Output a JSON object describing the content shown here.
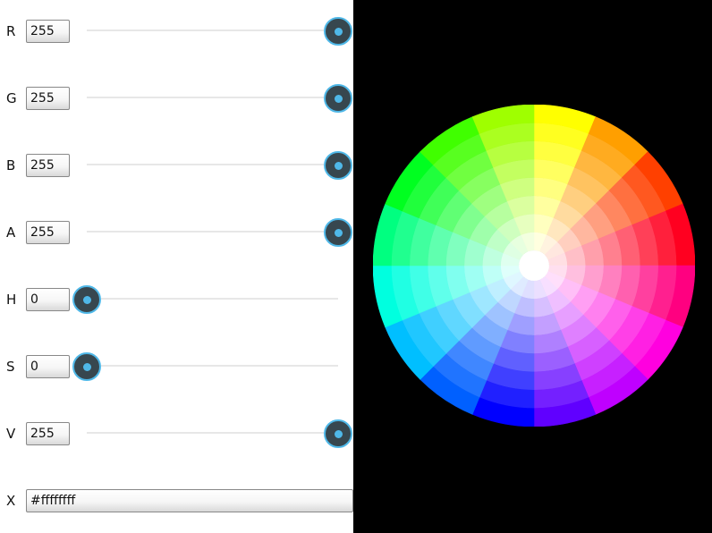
{
  "controls": {
    "rows": [
      {
        "key": "r",
        "label": "R",
        "value": "255",
        "slider_fraction": 1.0
      },
      {
        "key": "g",
        "label": "G",
        "value": "255",
        "slider_fraction": 1.0
      },
      {
        "key": "b",
        "label": "B",
        "value": "255",
        "slider_fraction": 1.0
      },
      {
        "key": "a",
        "label": "A",
        "value": "255",
        "slider_fraction": 1.0
      },
      {
        "key": "h",
        "label": "H",
        "value": "0",
        "slider_fraction": 0.0
      },
      {
        "key": "s",
        "label": "S",
        "value": "0",
        "slider_fraction": 0.0
      },
      {
        "key": "v",
        "label": "V",
        "value": "255",
        "slider_fraction": 1.0
      }
    ],
    "hex": {
      "label": "X",
      "value": "#ffffffff"
    }
  },
  "colors": {
    "panel_bg": "#ffffff",
    "wheel_bg": "#000000",
    "thumb_fill": "#37474f",
    "thumb_accent": "#4fb8e8",
    "selected_color": "#ffffff"
  },
  "color_wheel": {
    "hue_segments": 16,
    "saturation_rings": 8,
    "start_hue_degrees": 60,
    "direction": "clockwise"
  }
}
